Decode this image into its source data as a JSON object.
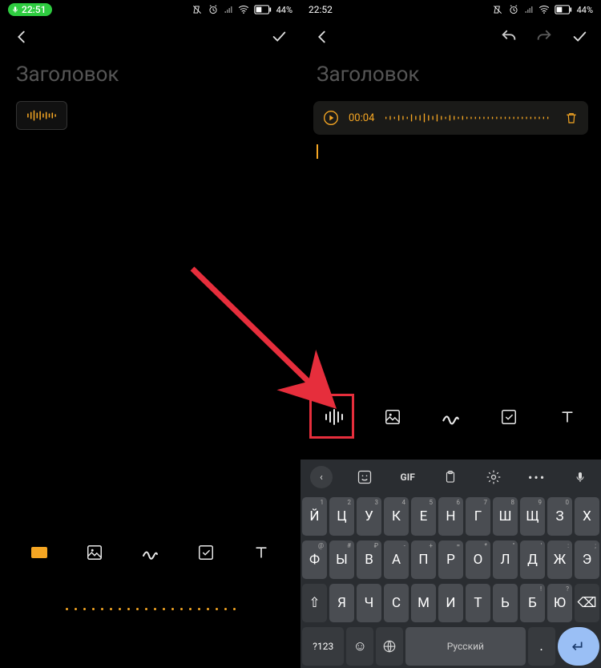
{
  "left": {
    "status": {
      "time": "22:51",
      "battery": "44%"
    },
    "title_placeholder": "Заголовок",
    "toolbar": {
      "audio": "audio",
      "image": "image",
      "draw": "draw",
      "checklist": "checklist",
      "text": "text"
    }
  },
  "right": {
    "status": {
      "time": "22:52",
      "battery": "44%"
    },
    "title_placeholder": "Заголовок",
    "audio": {
      "duration": "00:04"
    },
    "toolbar": {
      "audio": "audio",
      "image": "image",
      "draw": "draw",
      "checklist": "checklist",
      "text": "text"
    },
    "gboard_top": {
      "gif": "GIF"
    },
    "keyboard": {
      "row1": [
        {
          "main": "Й",
          "sup": "1"
        },
        {
          "main": "Ц",
          "sup": "2"
        },
        {
          "main": "У",
          "sup": "3"
        },
        {
          "main": "К",
          "sup": "4"
        },
        {
          "main": "Е",
          "sup": "5"
        },
        {
          "main": "Н",
          "sup": "6"
        },
        {
          "main": "Г",
          "sup": "7"
        },
        {
          "main": "Ш",
          "sup": "8"
        },
        {
          "main": "Щ",
          "sup": "9"
        },
        {
          "main": "З",
          "sup": "0"
        },
        {
          "main": "Х",
          "sup": ""
        }
      ],
      "row2": [
        {
          "main": "Ф",
          "sup": "@"
        },
        {
          "main": "Ы",
          "sup": "#"
        },
        {
          "main": "В",
          "sup": "₽"
        },
        {
          "main": "А",
          "sup": "-"
        },
        {
          "main": "П",
          "sup": "+"
        },
        {
          "main": "Р",
          "sup": "="
        },
        {
          "main": "О",
          "sup": "*"
        },
        {
          "main": "Л",
          "sup": "\""
        },
        {
          "main": "Д",
          "sup": "'"
        },
        {
          "main": "Ж",
          "sup": ":"
        },
        {
          "main": "Э",
          "sup": ";"
        }
      ],
      "row3": [
        {
          "main": "⇧",
          "dark": true,
          "sup": ""
        },
        {
          "main": "Я",
          "sup": ""
        },
        {
          "main": "Ч",
          "sup": ""
        },
        {
          "main": "С",
          "sup": ""
        },
        {
          "main": "М",
          "sup": ""
        },
        {
          "main": "И",
          "sup": ""
        },
        {
          "main": "Т",
          "sup": ""
        },
        {
          "main": "Ь",
          "sup": ""
        },
        {
          "main": "Б",
          "sup": "!"
        },
        {
          "main": "Ю",
          "sup": "?"
        },
        {
          "main": "⌫",
          "dark": true,
          "sup": ""
        }
      ],
      "row4": {
        "symbols": "?123",
        "lang_label": "Русский"
      }
    }
  }
}
